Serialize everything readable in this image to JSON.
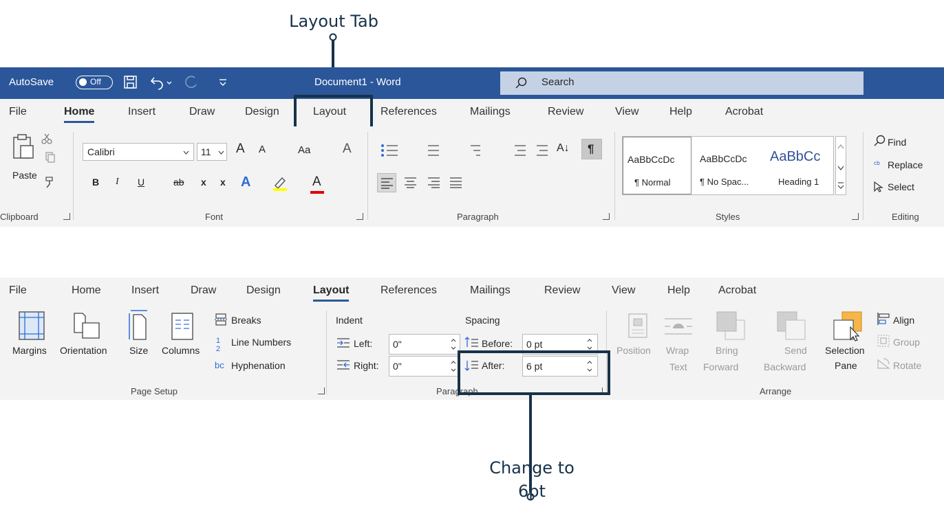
{
  "callouts": {
    "layout_tab": "Layout Tab",
    "change_to": "Change to",
    "change_to_value": "6pt"
  },
  "colors": {
    "titlebar": "#2b579a",
    "callout": "#17324a",
    "search_bg": "#c5d2e6"
  },
  "titlebar": {
    "autosave": "AutoSave",
    "toggle": "Off",
    "document": "Document1  -  Word",
    "search": "Search"
  },
  "home_tabs": [
    "File",
    "Home",
    "Insert",
    "Draw",
    "Design",
    "Layout",
    "References",
    "Mailings",
    "Review",
    "View",
    "Help",
    "Acrobat"
  ],
  "layout_tabs": [
    "File",
    "Home",
    "Insert",
    "Draw",
    "Design",
    "Layout",
    "References",
    "Mailings",
    "Review",
    "View",
    "Help",
    "Acrobat"
  ],
  "home_ribbon": {
    "paste": "Paste",
    "font_name": "Calibri",
    "font_size": "11",
    "grow": "A",
    "shrink": "A",
    "change_case": "Aa",
    "bold": "B",
    "italic": "I",
    "underline": "U",
    "strike": "ab",
    "subscript": "x",
    "superscript": "x",
    "font_color": "A",
    "text_effects": "A",
    "styles": [
      {
        "preview": "AaBbCcDc",
        "name": "¶ Normal"
      },
      {
        "preview": "AaBbCcDc",
        "name": "¶ No Spac..."
      },
      {
        "preview": "AaBbCc",
        "name": "Heading 1"
      }
    ],
    "find": "Find",
    "replace": "Replace",
    "select": "Select",
    "groups": {
      "clipboard": "Clipboard",
      "font": "Font",
      "paragraph": "Paragraph",
      "styles": "Styles",
      "editing": "Editing"
    }
  },
  "layout_ribbon": {
    "margins": "Margins",
    "orientation": "Orientation",
    "size": "Size",
    "columns": "Columns",
    "breaks": "Breaks",
    "line_numbers": "Line Numbers",
    "hyphenation": "Hyphenation",
    "indent": "Indent",
    "spacing": "Spacing",
    "left": "Left:",
    "left_value": "0\"",
    "right": "Right:",
    "right_value": "0\"",
    "before": "Before:",
    "before_value": "0 pt",
    "after": "After:",
    "after_value": "6 pt",
    "position": "Position",
    "wrap": "Wrap",
    "wrap2": "Text",
    "bring": "Bring",
    "bring2": "Forward",
    "send": "Send",
    "send2": "Backward",
    "selection": "Selection",
    "selection2": "Pane",
    "align": "Align",
    "group": "Group",
    "rotate": "Rotate",
    "groups": {
      "page_setup": "Page Setup",
      "paragraph": "Paragraph",
      "arrange": "Arrange"
    }
  }
}
